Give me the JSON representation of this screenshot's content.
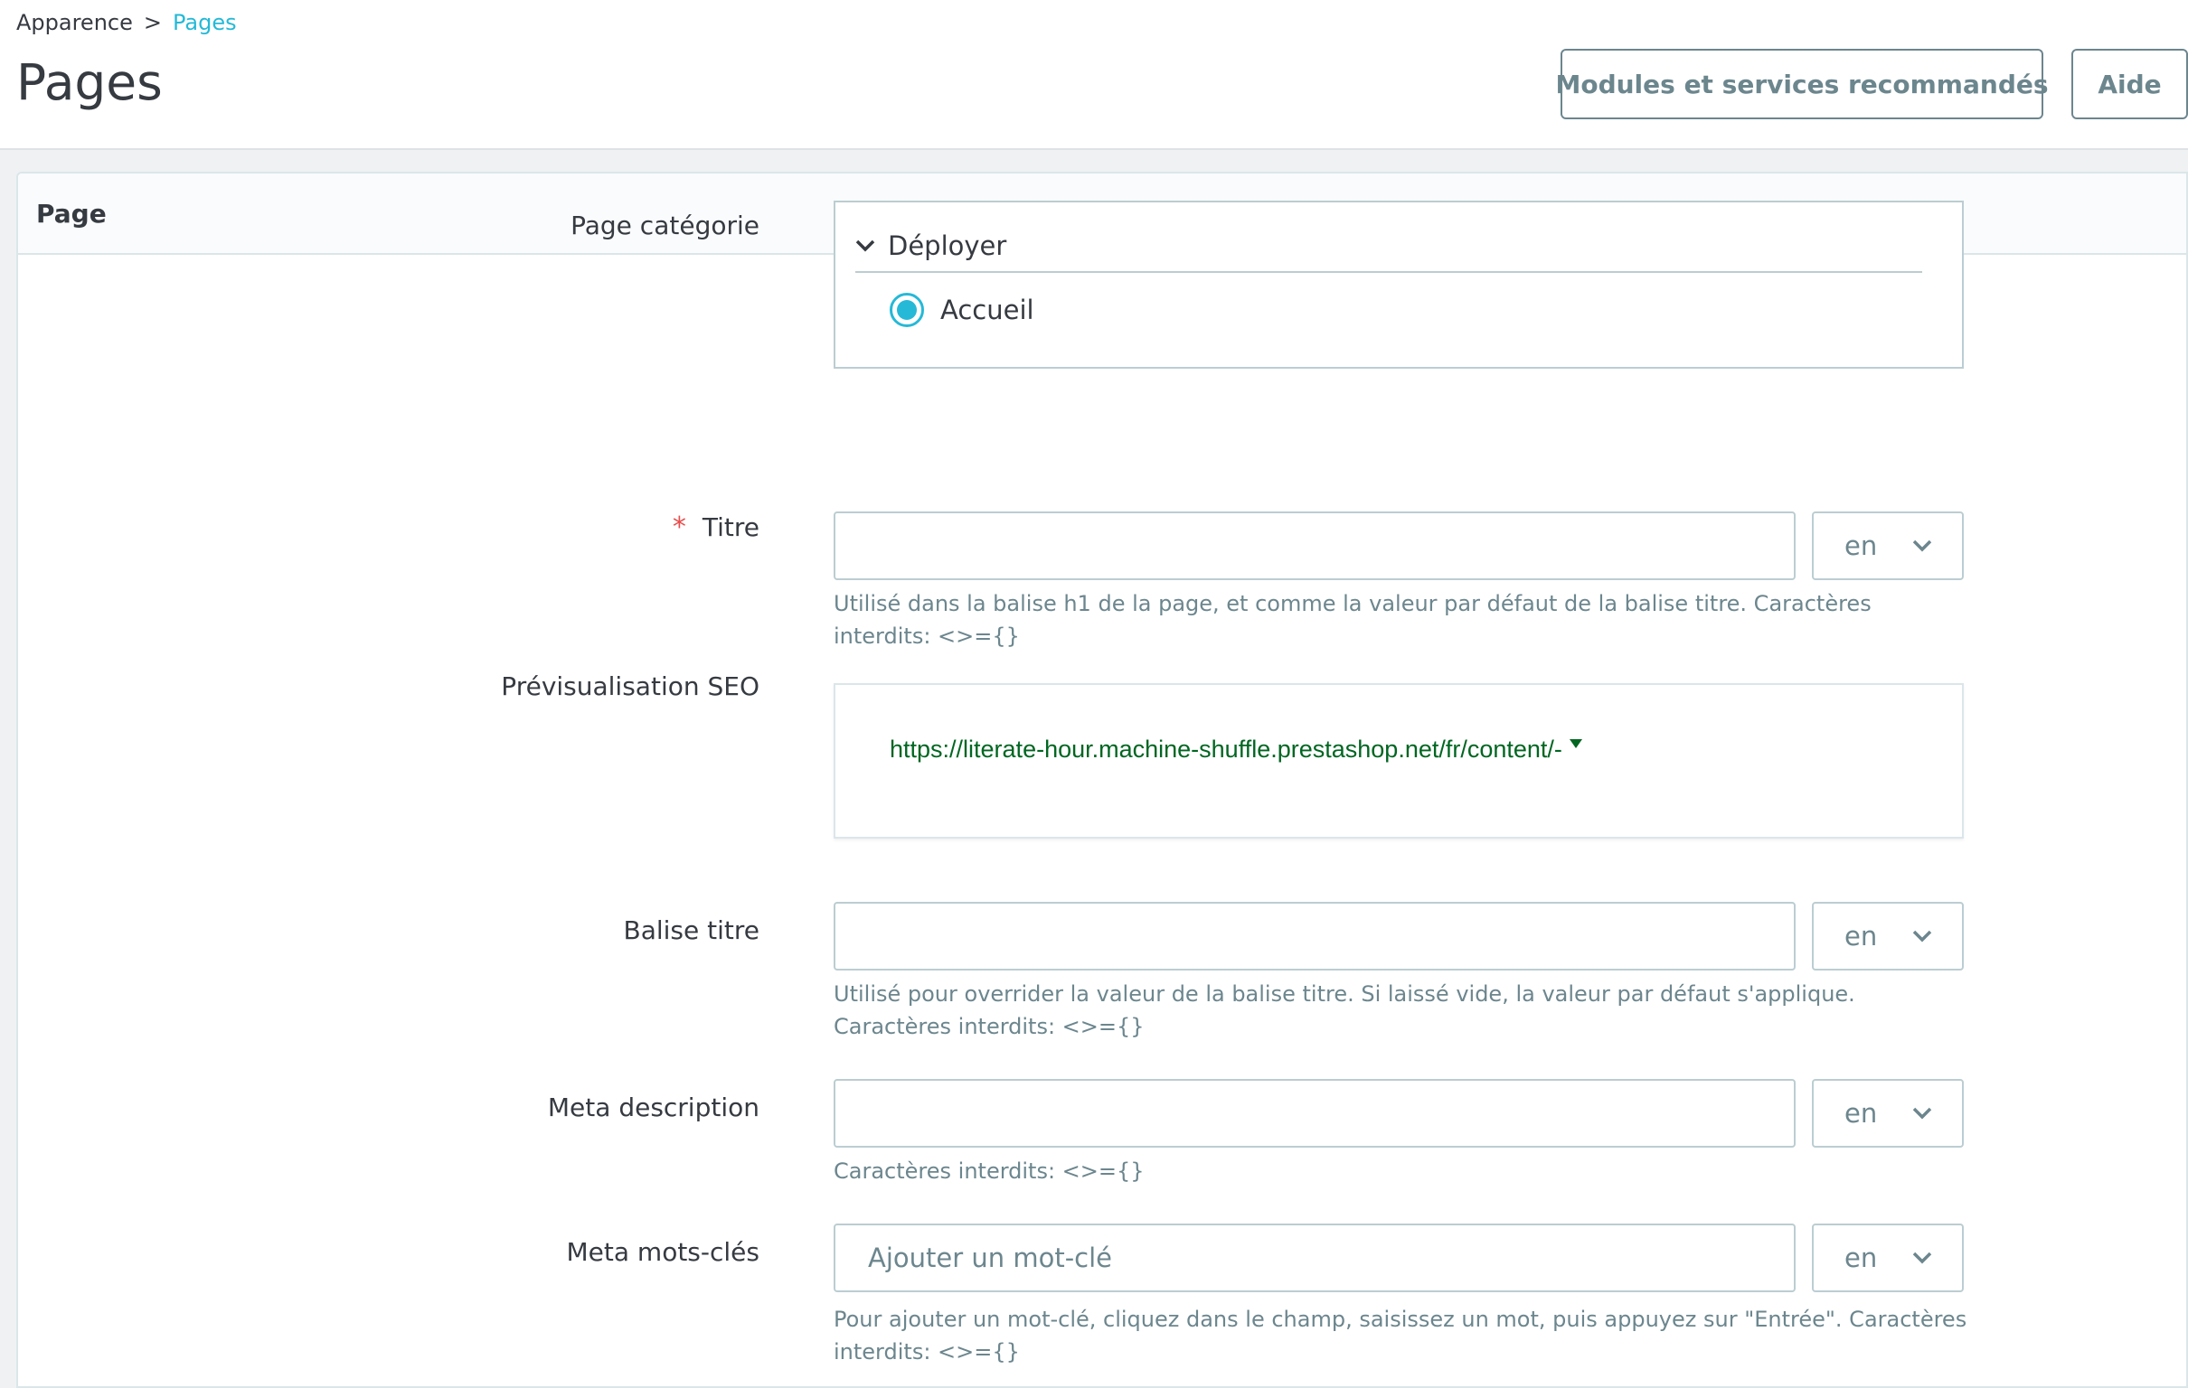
{
  "breadcrumb": {
    "parent": "Apparence",
    "separator": ">",
    "current": "Pages"
  },
  "header": {
    "title": "Pages",
    "buttons": {
      "modules": "Modules et services recommandés",
      "help": "Aide"
    }
  },
  "panel": {
    "title": "Page"
  },
  "form": {
    "category": {
      "label": "Page catégorie",
      "toggle": "Déployer",
      "selected_item": "Accueil"
    },
    "title": {
      "required_mark": "*",
      "label": "Titre",
      "value": "",
      "lang": "en",
      "help": "Utilisé dans la balise h1 de la page, et comme la valeur par défaut de la balise titre. Caractères interdits: <>={}"
    },
    "seo_preview": {
      "label": "Prévisualisation SEO",
      "url": "https://literate-hour.machine-shuffle.prestashop.net/fr/content/-"
    },
    "meta_title": {
      "label": "Balise titre",
      "value": "",
      "lang": "en",
      "help": "Utilisé pour overrider la valeur de la balise titre. Si laissé vide, la valeur par défaut s'applique. Caractères interdits: <>={}"
    },
    "meta_description": {
      "label": "Meta description",
      "value": "",
      "lang": "en",
      "help": "Caractères interdits: <>={}"
    },
    "meta_keywords": {
      "label": "Meta mots-clés",
      "placeholder": "Ajouter un mot-clé",
      "lang": "en",
      "help": "Pour ajouter un mot-clé, cliquez dans le champ, saisissez un mot, puis appuyez sur \"Entrée\". Caractères interdits: <>={}"
    }
  },
  "colors": {
    "accent": "#25b9d7",
    "required": "#e84d4d",
    "seo_url": "#006621",
    "text": "#363a41",
    "muted": "#6c868e"
  },
  "icons": {
    "toggle": "chevron-down-icon",
    "lang": "chevron-down-icon",
    "seo": "caret-down-icon"
  }
}
